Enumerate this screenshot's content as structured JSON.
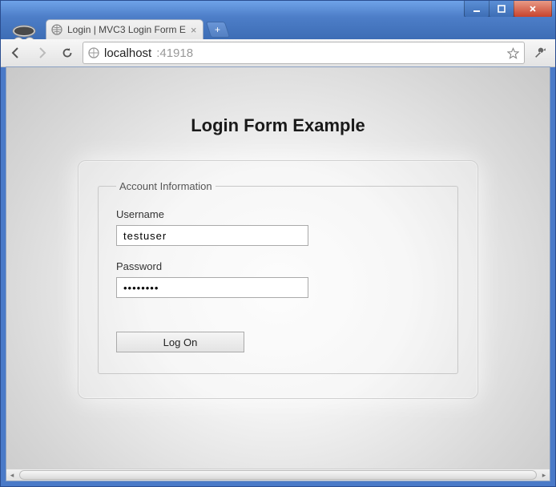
{
  "window": {
    "controls": {
      "minimize": "minimize",
      "maximize": "maximize",
      "close": "close"
    }
  },
  "browser": {
    "tab": {
      "title": "Login | MVC3 Login Form E",
      "close_glyph": "×"
    },
    "newtab_glyph": "+",
    "url": {
      "host": "localhost",
      "port": ":41918"
    }
  },
  "page": {
    "heading": "Login Form Example",
    "legend": "Account Information",
    "username": {
      "label": "Username",
      "value": "testuser"
    },
    "password": {
      "label": "Password",
      "value": "••••••••"
    },
    "submit_label": "Log On"
  },
  "scroll": {
    "left_glyph": "◂",
    "right_glyph": "▸"
  }
}
